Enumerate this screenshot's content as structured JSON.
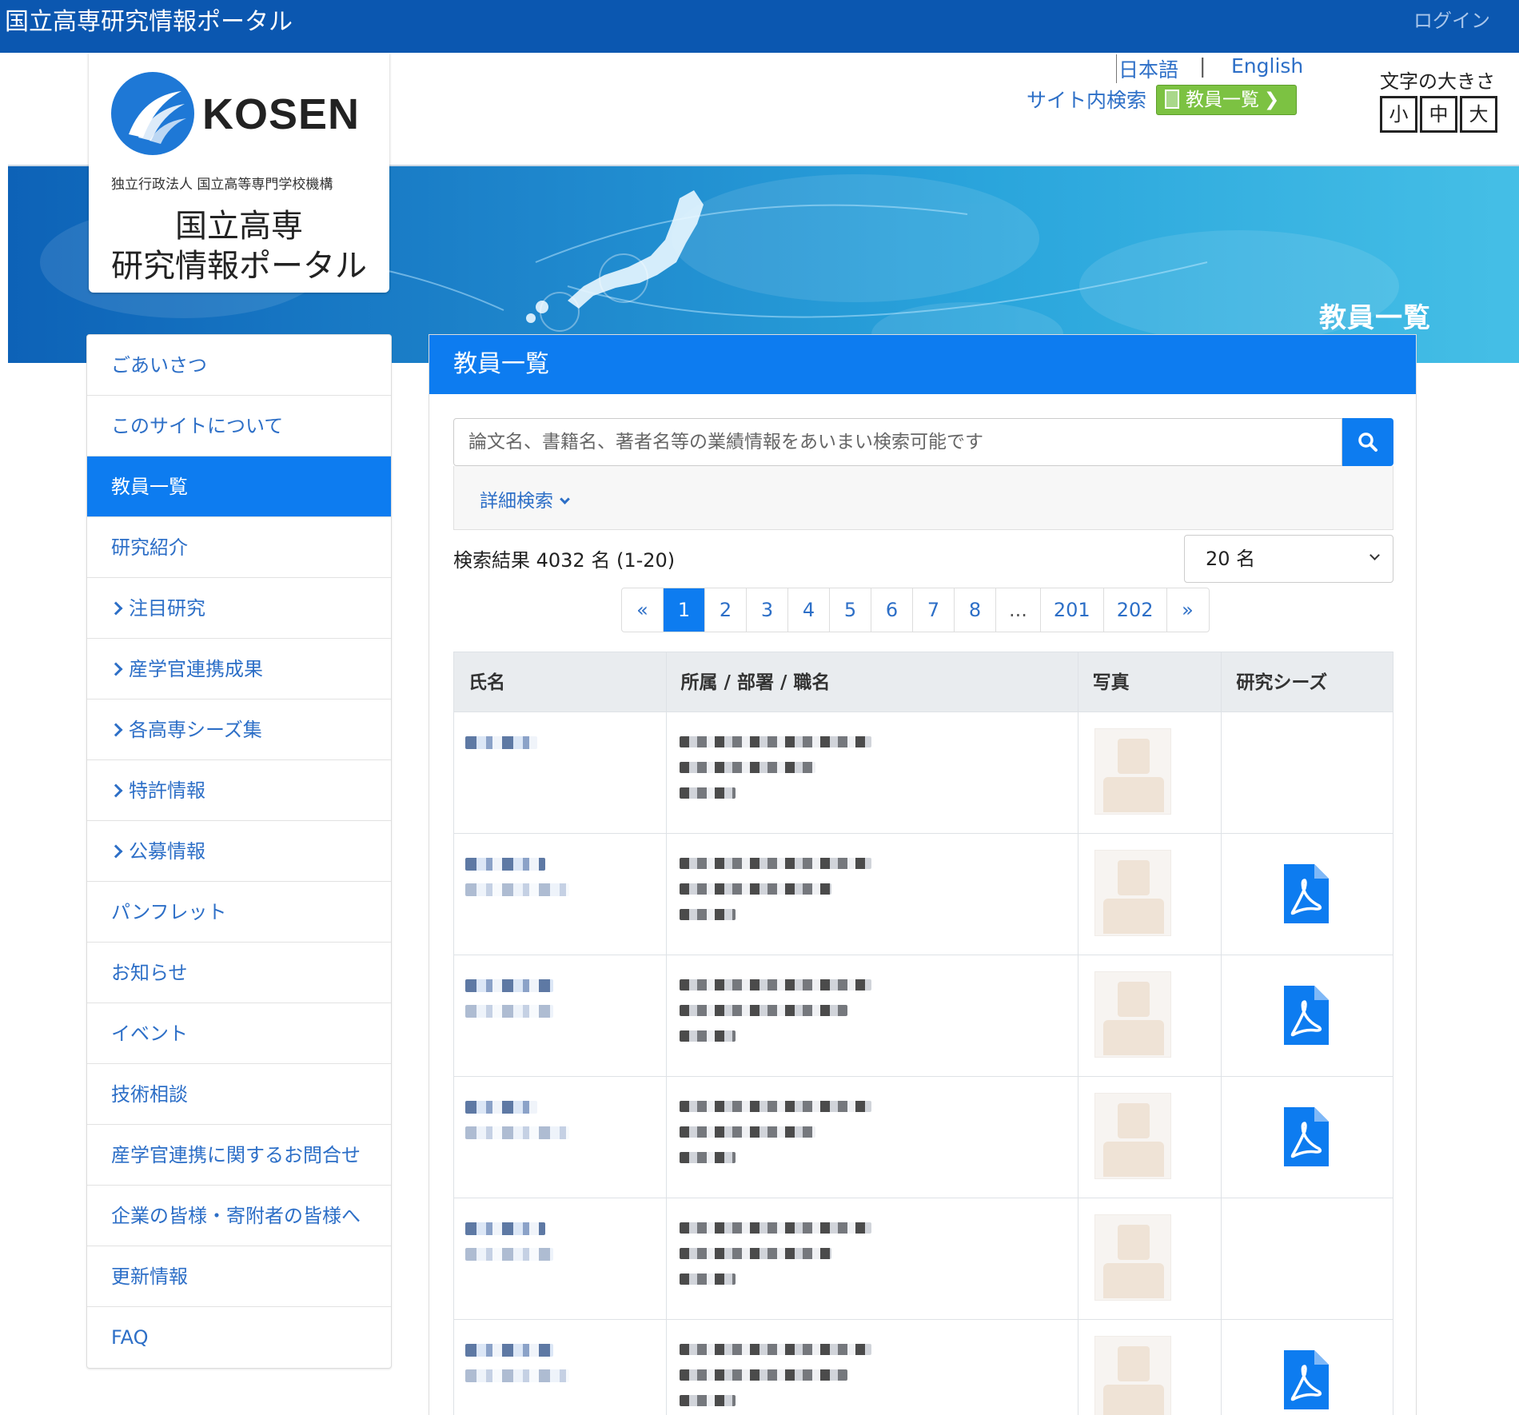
{
  "topbar": {
    "site_title": "国立高専研究情報ポータル",
    "login": "ログイン"
  },
  "header": {
    "lang_ja": "日本語",
    "lang_sep": "|",
    "lang_en": "English",
    "site_search": "サイト内検索",
    "faculty_button": "教員一覧",
    "font_size_label": "文字の大きさ",
    "font_sizes": [
      "小",
      "中",
      "大"
    ]
  },
  "logo": {
    "kosen": "KOSEN",
    "org": "独立行政法人 国立高等専門学校機構",
    "portal_line1": "国立高専",
    "portal_line2": "研究情報ポータル"
  },
  "banner": {
    "title": "教員一覧"
  },
  "sidebar": {
    "items": [
      {
        "label": "ごあいさつ",
        "caret": false
      },
      {
        "label": "このサイトについて",
        "caret": false
      },
      {
        "label": "教員一覧",
        "caret": false,
        "active": true
      },
      {
        "label": "研究紹介",
        "caret": false
      },
      {
        "label": "注目研究",
        "caret": true
      },
      {
        "label": "産学官連携成果",
        "caret": true
      },
      {
        "label": "各高専シーズ集",
        "caret": true
      },
      {
        "label": "特許情報",
        "caret": true
      },
      {
        "label": "公募情報",
        "caret": true
      },
      {
        "label": "パンフレット",
        "caret": false
      },
      {
        "label": "お知らせ",
        "caret": false
      },
      {
        "label": "イベント",
        "caret": false
      },
      {
        "label": "技術相談",
        "caret": false
      },
      {
        "label": "産学官連携に関するお問合せ",
        "caret": false
      },
      {
        "label": "企業の皆様・寄附者の皆様へ",
        "caret": false
      },
      {
        "label": "更新情報",
        "caret": false
      },
      {
        "label": "FAQ",
        "caret": false
      }
    ]
  },
  "main": {
    "title": "教員一覧",
    "search_placeholder": "論文名、書籍名、著者名等の業績情報をあいまい検索可能です",
    "advanced_search": "詳細検索",
    "result_count": "検索結果 4032 名 (1-20)",
    "per_page": "20 名",
    "pagination": [
      "«",
      "1",
      "2",
      "3",
      "4",
      "5",
      "6",
      "7",
      "8",
      "...",
      "201",
      "202",
      "»"
    ],
    "pagination_active": "1",
    "table": {
      "headers": [
        "氏名",
        "所属 / 部署 / 職名",
        "写真",
        "研究シーズ"
      ],
      "rows": [
        {
          "has_seeds_pdf": false
        },
        {
          "has_seeds_pdf": true
        },
        {
          "has_seeds_pdf": true
        },
        {
          "has_seeds_pdf": true
        },
        {
          "has_seeds_pdf": false
        },
        {
          "has_seeds_pdf": true
        }
      ]
    }
  },
  "colors": {
    "topbar": "#0b57b0",
    "accent": "#0d7cf0",
    "link": "#2d6fc7",
    "green_button": "#7cc242"
  }
}
